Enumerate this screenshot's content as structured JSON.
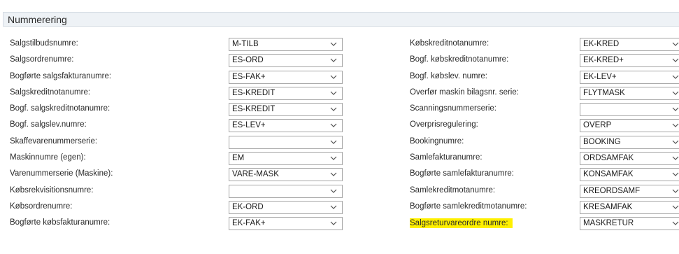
{
  "section": {
    "title": "Nummerering"
  },
  "left": [
    {
      "label": "Salgstilbudsnumre:",
      "value": "M-TILB"
    },
    {
      "label": "Salgsordrenumre:",
      "value": "ES-ORD"
    },
    {
      "label": "Bogførte salgsfakturanumre:",
      "value": "ES-FAK+"
    },
    {
      "label": "Salgskreditnotanumre:",
      "value": "ES-KREDIT"
    },
    {
      "label": "Bogf. salgskreditnotanumre:",
      "value": "ES-KREDIT"
    },
    {
      "label": "Bogf. salgslev.numre:",
      "value": "ES-LEV+"
    },
    {
      "label": "Skaffevarenummerserie:",
      "value": ""
    },
    {
      "label": "Maskinnumre (egen):",
      "value": "EM"
    },
    {
      "label": "Varenummerserie (Maskine):",
      "value": "VARE-MASK"
    },
    {
      "label": "Købsrekvisitionsnumre:",
      "value": ""
    },
    {
      "label": "Købsordrenumre:",
      "value": "EK-ORD"
    },
    {
      "label": "Bogførte købsfakturanumre:",
      "value": "EK-FAK+"
    }
  ],
  "right": [
    {
      "label": "Købskreditnotanumre:",
      "value": "EK-KRED"
    },
    {
      "label": "Bogf. købskreditnotanumre:",
      "value": "EK-KRED+"
    },
    {
      "label": "Bogf. købslev. numre:",
      "value": "EK-LEV+"
    },
    {
      "label": "Overfør maskin bilagsnr. serie:",
      "value": "FLYTMASK"
    },
    {
      "label": "Scanningsnummerserie:",
      "value": ""
    },
    {
      "label": "Overprisregulering:",
      "value": "OVERP"
    },
    {
      "label": "Bookingnumre:",
      "value": "BOOKING"
    },
    {
      "label": "Samlefakturanumre:",
      "value": "ORDSAMFAK"
    },
    {
      "label": "Bogførte samlefakturanumre:",
      "value": "KONSAMFAK"
    },
    {
      "label": "Samlekreditmotanumre:",
      "value": "KREORDSAMF"
    },
    {
      "label": "Bogførte samlekreditmotanumre:",
      "value": "KRESAMFAK"
    },
    {
      "label": "Salgsreturvareordre numre:",
      "value": "MASKRETUR"
    }
  ],
  "highlight": {
    "color": "#fff000",
    "row": "right.11"
  },
  "icons": {
    "dropdown": "chevron-down-icon"
  }
}
